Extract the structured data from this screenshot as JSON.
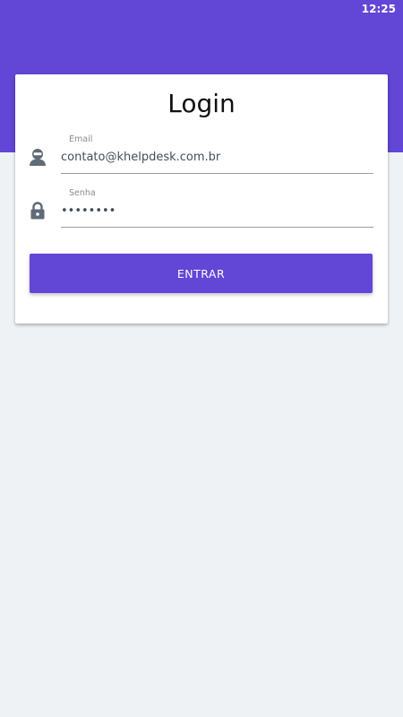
{
  "status_bar": {
    "time": "12:25"
  },
  "login": {
    "title": "Login",
    "email": {
      "label": "Email",
      "value": "contato@khelpdesk.com.br",
      "icon": "user-icon"
    },
    "password": {
      "label": "Senha",
      "value": "••••••••",
      "icon": "lock-icon"
    },
    "submit_label": "ENTRAR"
  },
  "colors": {
    "accent": "#6246d6",
    "background": "#eff2f4",
    "card": "#ffffff",
    "icon": "#5f6b76"
  }
}
